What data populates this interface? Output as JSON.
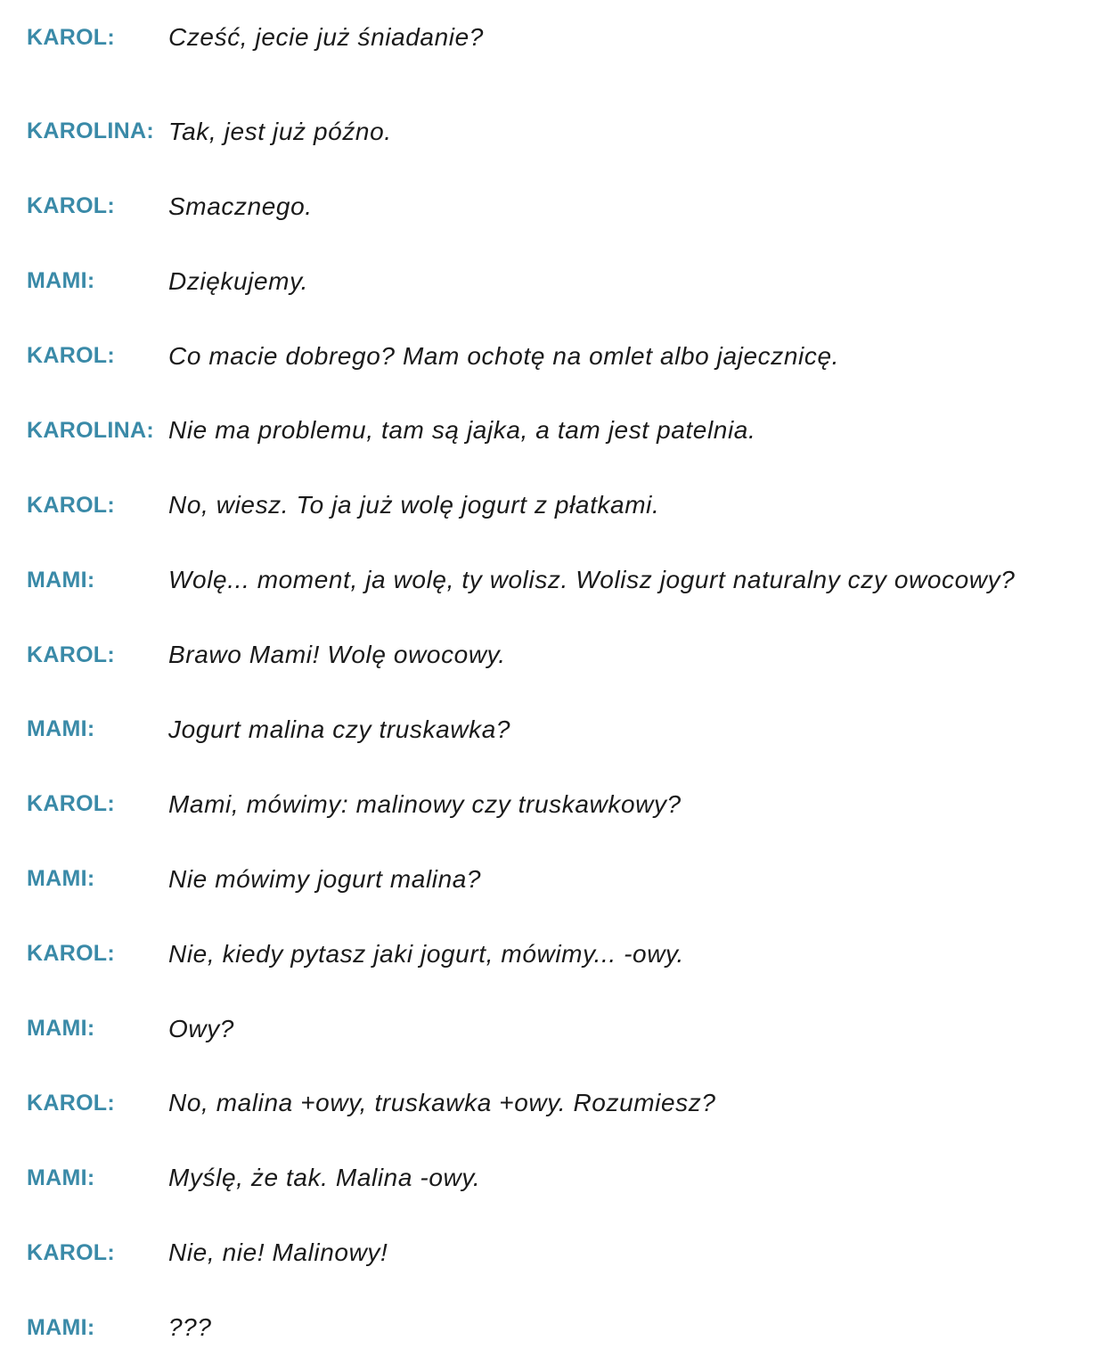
{
  "colors": {
    "speaker": "#3a8aa8",
    "text": "#1a1a1a"
  },
  "dialogue": [
    {
      "speaker": "KAROL:",
      "text": "Cześć, jecie już śniadanie?"
    },
    {
      "speaker": "KAROLINA:",
      "text": "Tak, jest już późno."
    },
    {
      "speaker": "KAROL:",
      "text": "Smacznego."
    },
    {
      "speaker": "MAMI:",
      "text": "Dziękujemy."
    },
    {
      "speaker": "KAROL:",
      "text": "Co macie dobrego? Mam ochotę na omlet albo jajecznicę."
    },
    {
      "speaker": "KAROLINA:",
      "text": "Nie ma problemu, tam są jajka, a tam jest patelnia."
    },
    {
      "speaker": "KAROL:",
      "text": "No, wiesz. To ja już wolę jogurt z płatkami."
    },
    {
      "speaker": "MAMI:",
      "text": "Wolę... moment, ja wolę, ty wolisz. Wolisz jogurt naturalny czy owocowy?"
    },
    {
      "speaker": "KAROL:",
      "text": "Brawo Mami! Wolę owocowy."
    },
    {
      "speaker": "MAMI:",
      "text": "Jogurt malina czy truskawka?"
    },
    {
      "speaker": "KAROL:",
      "text": "Mami, mówimy: malinowy czy truskawkowy?"
    },
    {
      "speaker": "MAMI:",
      "text": "Nie mówimy jogurt malina?"
    },
    {
      "speaker": "KAROL:",
      "text": "Nie, kiedy pytasz jaki jogurt, mówimy... -owy."
    },
    {
      "speaker": "MAMI:",
      "text": "Owy?"
    },
    {
      "speaker": "KAROL:",
      "text": "No, malina +owy, truskawka +owy. Rozumiesz?"
    },
    {
      "speaker": "MAMI:",
      "text": "Myślę, że tak. Malina -owy."
    },
    {
      "speaker": "KAROL:",
      "text": "Nie, nie! Malinowy!"
    },
    {
      "speaker": "MAMI:",
      "text": "???"
    }
  ]
}
